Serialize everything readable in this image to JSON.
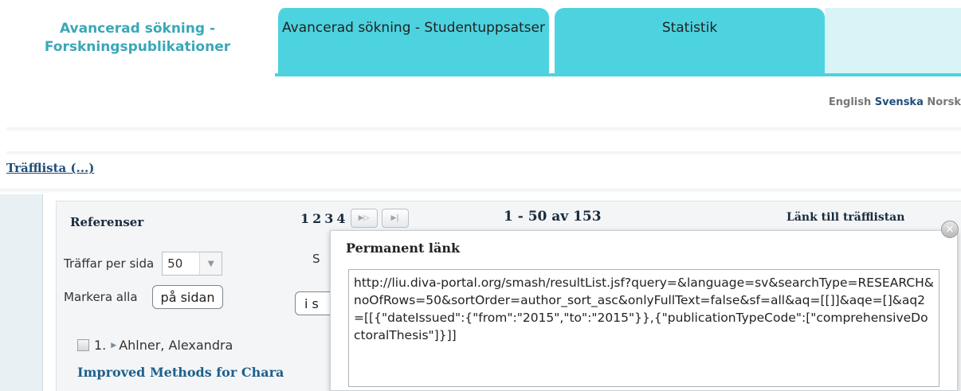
{
  "tabs": [
    {
      "label": "Avancerad sökning - Forskningspublikationer"
    },
    {
      "label": "Avancerad sökning - Studentuppsatser"
    },
    {
      "label": "Statistik"
    }
  ],
  "languages": {
    "en": "English",
    "sv": "Svenska",
    "no": "Norsk"
  },
  "breadcrumb": "Träfflista (...)",
  "results": {
    "heading": "Referenser",
    "pages": [
      "1",
      "2",
      "3",
      "4"
    ],
    "next_icon": "next-page-icon",
    "last_icon": "last-page-icon",
    "range": "1 - 50 av 153",
    "link_label": "Länk till träfflistan"
  },
  "controls": {
    "per_page_label": "Träffar per sida",
    "per_page_value": "50",
    "partial_label": "S",
    "mark_all_label": "Markera alla",
    "on_page_button": "på sidan",
    "in_search_button": "i s"
  },
  "first_result": {
    "index": "1.",
    "author": "Ahlner, Alexandra",
    "title": "Improved Methods for Chara"
  },
  "popup": {
    "title": "Permanent länk",
    "url": "http://liu.diva-portal.org/smash/resultList.jsf?query=&language=sv&searchType=RESEARCH&noOfRows=50&sortOrder=author_sort_asc&onlyFullText=false&sf=all&aq=[[]]&aqe=[]&aq2=[[{\"dateIssued\":{\"from\":\"2015\",\"to\":\"2015\"}},{\"publicationTypeCode\":[\"comprehensiveDoctoralThesis\"]}]]"
  },
  "colors": {
    "tab_active_text": "#3aa7b8",
    "tab_bg": "#4dd3df",
    "link": "#1f5f8b"
  }
}
